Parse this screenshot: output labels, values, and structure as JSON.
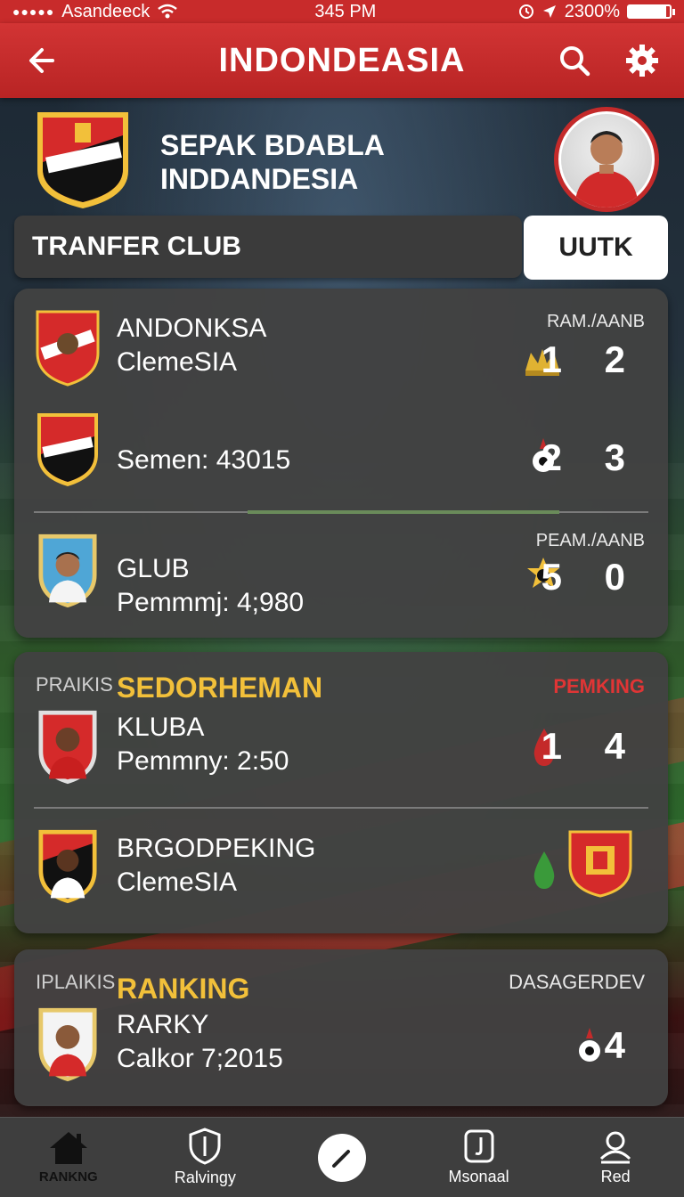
{
  "status": {
    "carrier": "Asandeeck",
    "time": "345 PM",
    "battery": "2300%"
  },
  "header": {
    "title": "INDONDEASIA"
  },
  "team": {
    "name_line1": "SEPAK BDABLA",
    "name_line2": "INDDANDESIA"
  },
  "transfer": {
    "label": "TRANFER CLUB",
    "button": "UUTK"
  },
  "card1": {
    "rows": [
      {
        "line1": "ANDONKSA",
        "line2": "ClemeSIA",
        "right_label": "RAM./AANB",
        "score": "1 2"
      },
      {
        "line1": "",
        "line2": "Semen: 43015",
        "right_label": "",
        "score": "2 3"
      },
      {
        "line1": "GLUB",
        "line2": "Pemmmj: 4;980",
        "right_label": "PEAM./AANB",
        "score": "5 0"
      }
    ]
  },
  "card2": {
    "section_label": "PRAIKIS",
    "section_title": "SEDORHEMAN",
    "section_right": "PEMKING",
    "rows": [
      {
        "line1": "KLUBA",
        "line2": "Pemmny: 2:50",
        "score": "1 4"
      },
      {
        "line1": "BRGODPEKING",
        "line2": "ClemeSIA",
        "score": ""
      }
    ]
  },
  "card3": {
    "section_label": "IPLAIKIS",
    "section_title": "RANKING",
    "section_right": "DASAGERDEV",
    "rows": [
      {
        "line1": "RARKY",
        "line2": "Calkor 7;2015",
        "score": "4"
      }
    ]
  },
  "nav": {
    "items": [
      {
        "label": "RANKNG",
        "icon": "home-icon"
      },
      {
        "label": "Ralvingy",
        "icon": "shield-icon"
      },
      {
        "label": "",
        "icon": "pencil-icon"
      },
      {
        "label": "Msonaal",
        "icon": "jersey-icon"
      },
      {
        "label": "Red",
        "icon": "profile-icon"
      }
    ]
  },
  "colors": {
    "header_red": "#c82b2b",
    "gold": "#f2c03a",
    "alert_red": "#e03535",
    "card_bg": "#424242"
  }
}
